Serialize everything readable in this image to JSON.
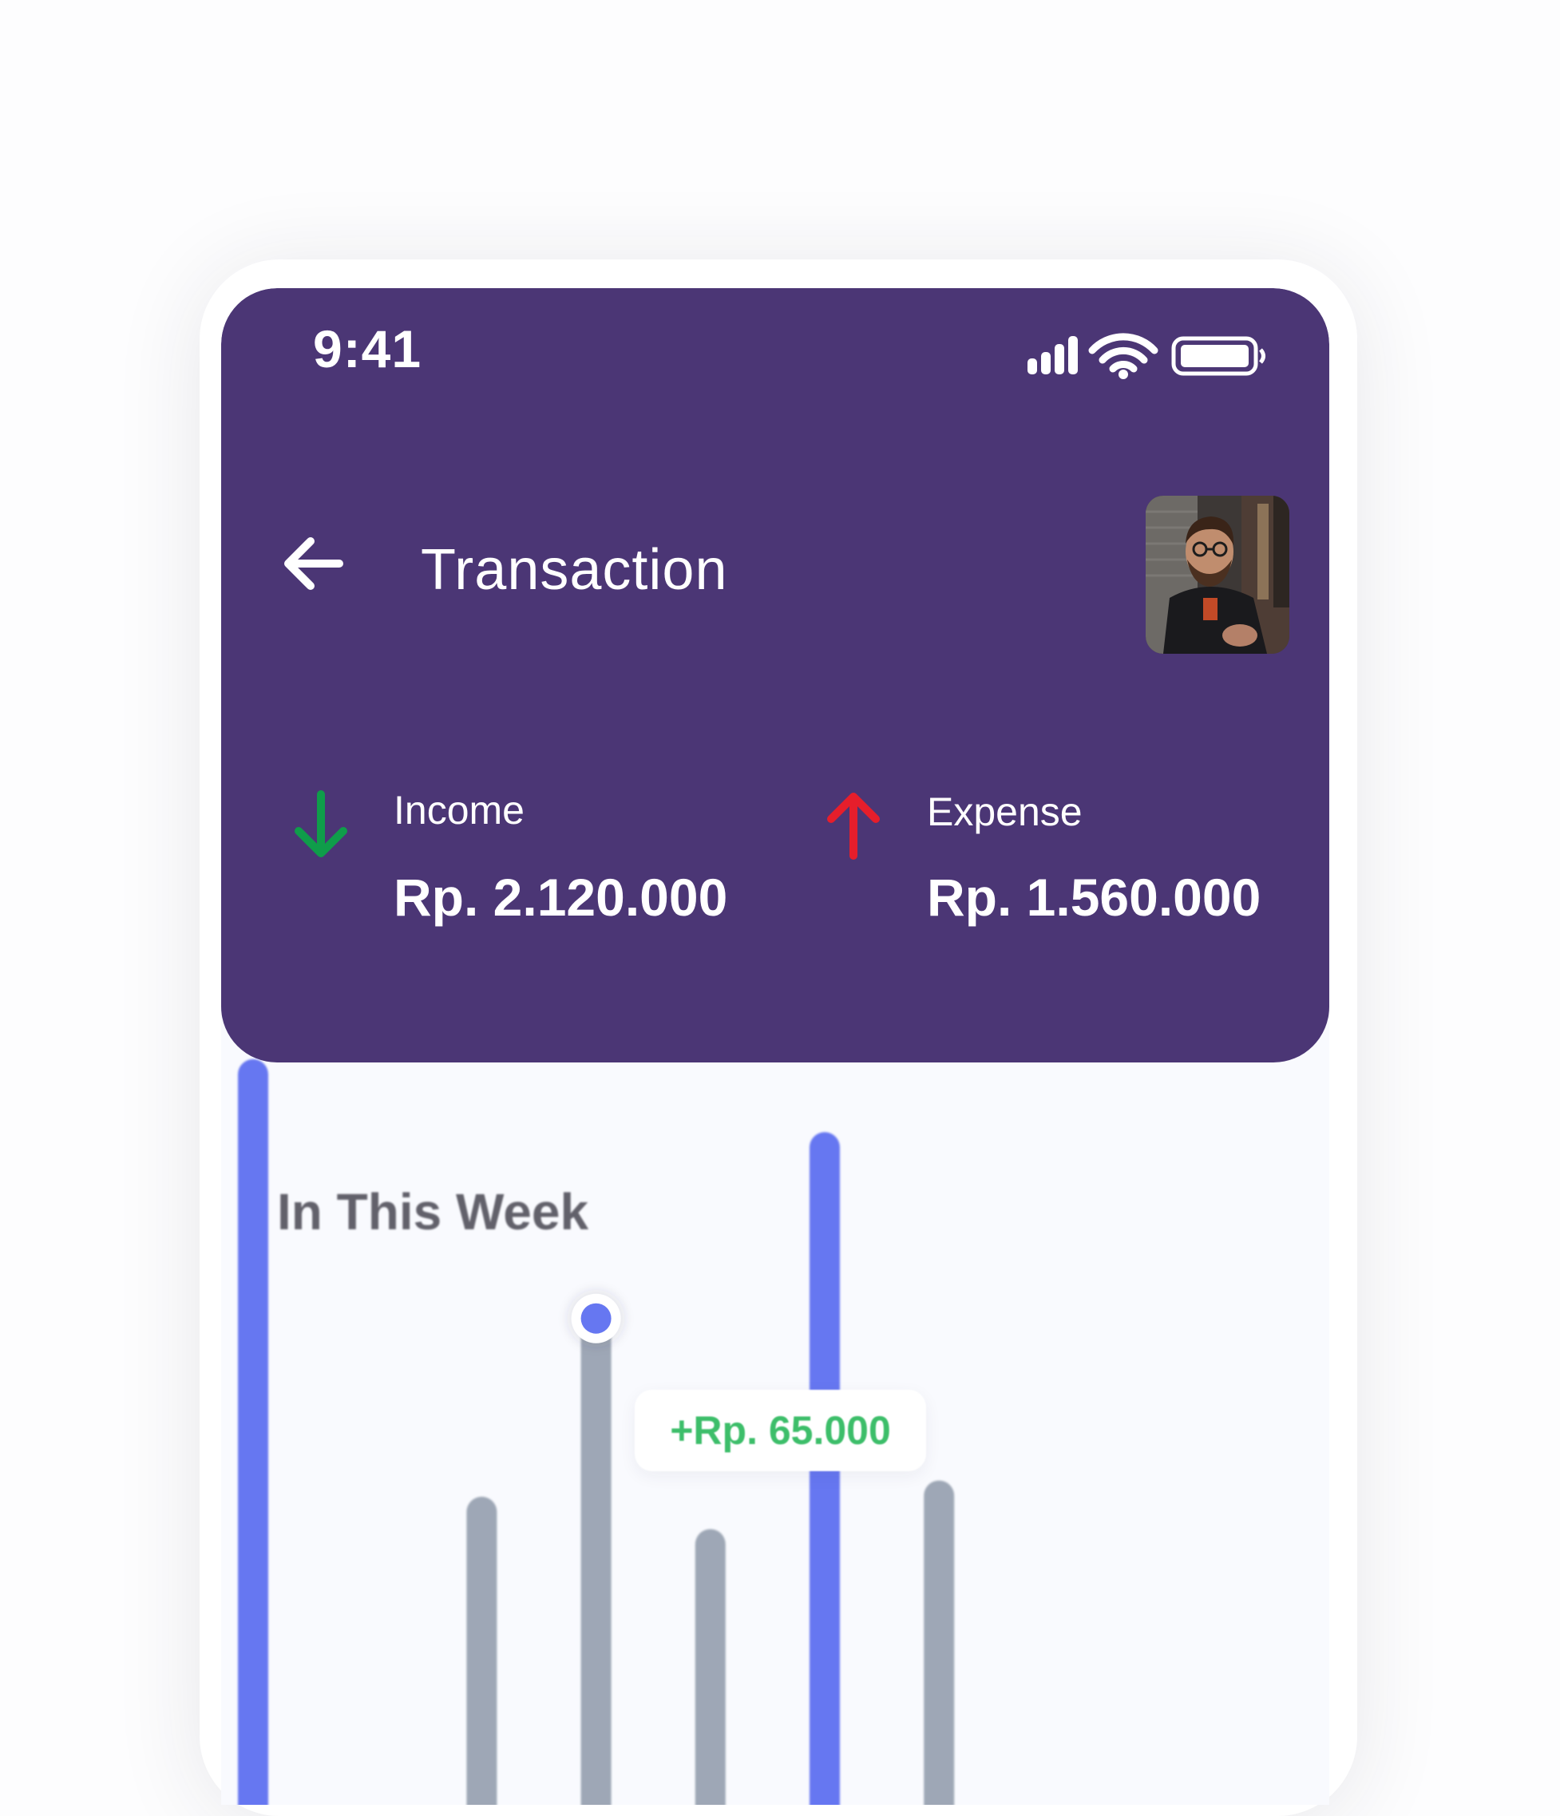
{
  "status_bar": {
    "time": "9:41",
    "icons": [
      "signal-icon",
      "wifi-icon",
      "battery-icon"
    ]
  },
  "header": {
    "back_icon": "arrow-left-icon",
    "title": "Transaction",
    "avatar": "profile-photo"
  },
  "summary": {
    "income": {
      "icon": "arrow-down-icon",
      "label": "Income",
      "value": "Rp. 2.120.000",
      "color": "#0f9d4a"
    },
    "expense": {
      "icon": "arrow-up-icon",
      "label": "Expense",
      "value": "Rp. 1.560.000",
      "color": "#e61e2b"
    }
  },
  "week": {
    "title": "In This Week",
    "tooltip": "+Rp. 65.000"
  },
  "colors": {
    "header_bg": "#4b3675",
    "accent": "#6677f1",
    "bar_muted": "#9ea7b6",
    "positive": "#3dbe6a"
  },
  "chart_data": {
    "type": "bar",
    "series": [
      {
        "values": [
          0.94,
          0,
          0.4,
          0.62,
          0.36,
          0.85,
          0.42
        ],
        "highlight": [
          true,
          false,
          false,
          false,
          false,
          true,
          false
        ],
        "selected_index": 3
      }
    ]
  }
}
